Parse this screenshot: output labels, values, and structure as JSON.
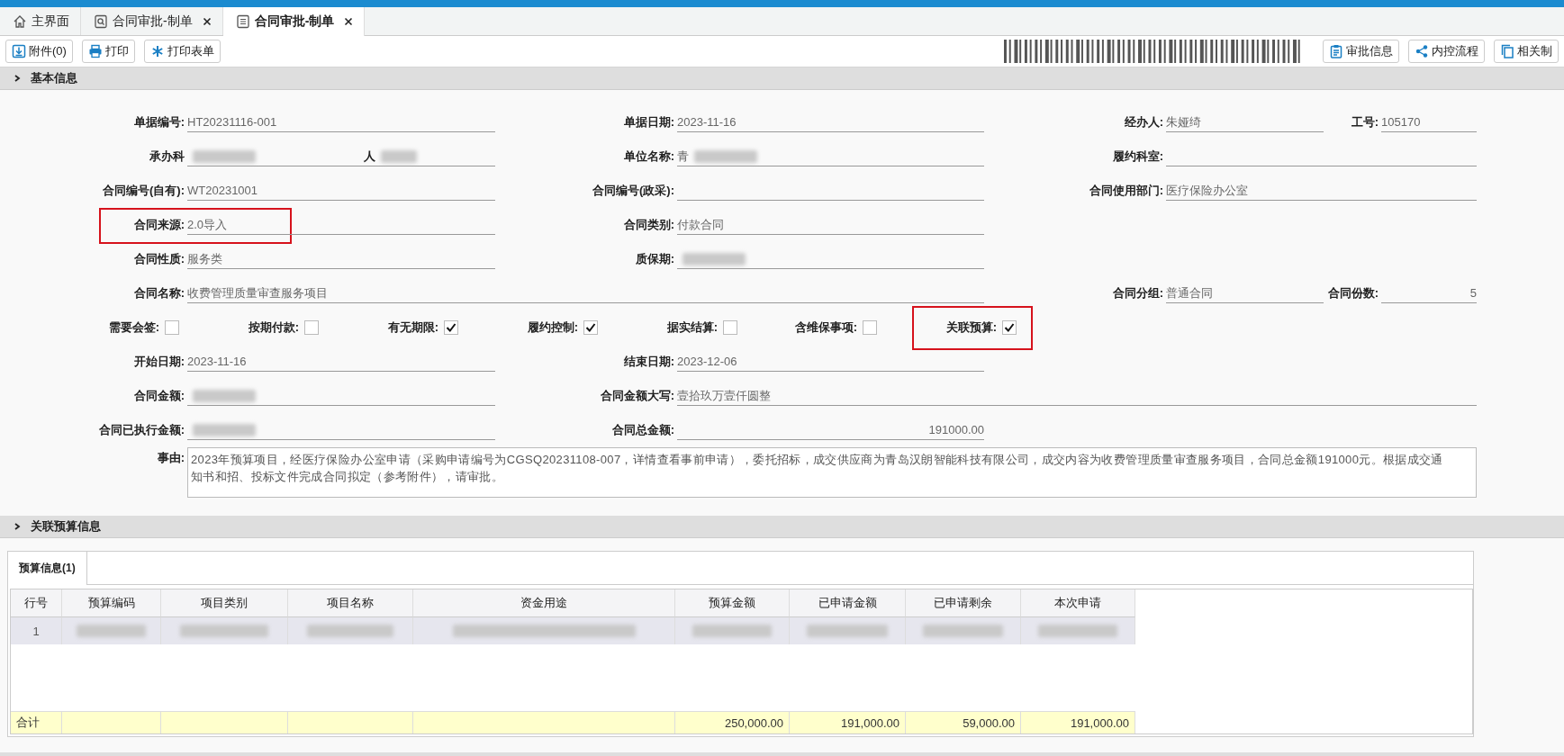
{
  "tabs": [
    {
      "label": "主界面",
      "closable": false,
      "selected": false
    },
    {
      "label": "合同审批-制单",
      "closable": true,
      "selected": false
    },
    {
      "label": "合同审批-制单",
      "closable": true,
      "selected": true
    }
  ],
  "toolbar_left": [
    "附件(0)",
    "打印",
    "打印表单"
  ],
  "toolbar_right": [
    "审批信息",
    "内控流程",
    "相关制"
  ],
  "basic_section": {
    "title": "基本信息",
    "expanded": false
  },
  "form_rows": [
    {
      "kind": "fields",
      "fields": [
        {
          "label": "单据编号:",
          "value": "HT20231116-001",
          "kind": "text"
        },
        {
          "label": "单据日期:",
          "value": "2023-11-16",
          "kind": "text"
        },
        {
          "label": "经办人:",
          "value": "朱娅绮",
          "kind": "text"
        },
        {
          "label": "工号:",
          "value": "105170",
          "kind": "text"
        }
      ]
    },
    {
      "kind": "fields",
      "fields": [
        {
          "label": "承办科",
          "kind": "text",
          "blurred": true,
          "suffix": "人"
        },
        {
          "label": "单位名称:",
          "value": "青",
          "kind": "text",
          "blurred": true
        },
        {
          "label": "履约科室:",
          "kind": "wide"
        }
      ]
    },
    {
      "kind": "fields",
      "fields": [
        {
          "label": "合同编号(自有):",
          "value": "WT20231001",
          "kind": "text"
        },
        {
          "label": "合同编号(政采):",
          "kind": "text"
        },
        {
          "label": "合同使用部门:",
          "value": "医疗保险办公室",
          "kind": "wide"
        }
      ]
    },
    {
      "kind": "fields",
      "fields": [
        {
          "label": "合同来源:",
          "value": "2.0导入",
          "kind": "text",
          "highlight": true
        },
        {
          "label": "合同类别:",
          "value": "付款合同",
          "kind": "text"
        }
      ]
    },
    {
      "kind": "fields",
      "fields": [
        {
          "label": "合同性质:",
          "value": "服务类",
          "kind": "text"
        },
        {
          "label": "质保期:",
          "kind": "text",
          "blurred": true
        }
      ]
    },
    {
      "kind": "fields",
      "fields": [
        {
          "label": "合同名称:",
          "value": "收费管理质量审查服务项目",
          "kind": "wide"
        },
        {
          "label": "合同分组:",
          "value": "普通合同",
          "kind": "text"
        },
        {
          "label": "合同份数:",
          "value": "5",
          "kind": "number"
        }
      ]
    },
    {
      "kind": "checks",
      "items": [
        {
          "label": "需要会签:",
          "checked": false
        },
        {
          "label": "按期付款:",
          "checked": false
        },
        {
          "label": "有无期限:",
          "checked": true
        },
        {
          "label": "履约控制:",
          "checked": true
        },
        {
          "label": "据实结算:",
          "checked": false
        },
        {
          "label": "含维保事项:",
          "checked": false
        },
        {
          "label": "关联预算:",
          "checked": true,
          "highlight": true
        }
      ]
    },
    {
      "kind": "fields",
      "fields": [
        {
          "label": "开始日期:",
          "value": "2023-11-16",
          "kind": "text"
        },
        {
          "label": "结束日期:",
          "value": "2023-12-06",
          "kind": "text"
        }
      ]
    },
    {
      "kind": "fields",
      "fields": [
        {
          "label": "合同金额:",
          "kind": "text",
          "blurred": true
        },
        {
          "label": "合同金额大写:",
          "value": "壹拾玖万壹仟圆整",
          "kind": "extra_wide"
        }
      ]
    },
    {
      "kind": "fields",
      "fields": [
        {
          "label": "合同已执行金额:",
          "kind": "text",
          "blurred": true
        },
        {
          "label": "合同总金额:",
          "value": "191000.00",
          "kind": "number"
        }
      ]
    },
    {
      "kind": "memo",
      "label": "事由:",
      "value": "2023年预算项目，经医疗保险办公室申请（采购申请编号为CGSQ20231108-007，详情查看事前申请），委托招标，成交供应商为青岛汉朗智能科技有限公司，成交内容为收费管理质量审查服务项目，合同总金额191000元。根据成交通知书和招、投标文件完成合同拟定（参考附件），请审批。"
    }
  ],
  "budget_section": {
    "title": "关联预算信息",
    "expanded": false
  },
  "budget_tab": {
    "label": "预算信息(1)",
    "selected": true
  },
  "table": {
    "columns": [
      "行号",
      "预算编码",
      "项目类别",
      "项目名称",
      "资金用途",
      "预算金额",
      "已申请金额",
      "已申请剩余",
      "本次申请"
    ],
    "rows": [
      {
        "row_no": "1",
        "blurred": true
      }
    ],
    "total": {
      "label": "合计",
      "values": [
        "250,000.00",
        "191,000.00",
        "59,000.00",
        "191,000.00"
      ]
    }
  }
}
